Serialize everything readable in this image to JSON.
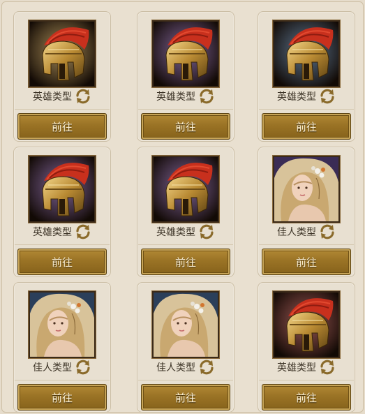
{
  "cards": [
    {
      "type_label": "英雄类型",
      "button_label": "前往",
      "portrait": "helmet",
      "bg": "#7a5a1e"
    },
    {
      "type_label": "英雄类型",
      "button_label": "前往",
      "portrait": "helmet",
      "bg": "#4a2a6e"
    },
    {
      "type_label": "英雄类型",
      "button_label": "前往",
      "portrait": "helmet",
      "bg": "#1f3f63"
    },
    {
      "type_label": "英雄类型",
      "button_label": "前往",
      "portrait": "helmet",
      "bg": "#4a2a6e"
    },
    {
      "type_label": "英雄类型",
      "button_label": "前往",
      "portrait": "helmet",
      "bg": "#4a2a6e"
    },
    {
      "type_label": "佳人类型",
      "button_label": "前往",
      "portrait": "maiden",
      "bg": "#3a2c55"
    },
    {
      "type_label": "佳人类型",
      "button_label": "前往",
      "portrait": "maiden",
      "bg": "#2b3f5a"
    },
    {
      "type_label": "佳人类型",
      "button_label": "前往",
      "portrait": "maiden",
      "bg": "#2b3f5a"
    },
    {
      "type_label": "英雄类型",
      "button_label": "前往",
      "portrait": "helmet",
      "bg": "#6a1a1a"
    }
  ],
  "icons": {
    "refresh": "refresh-icon",
    "helmet": "spartan-helmet-icon",
    "maiden": "maiden-portrait"
  }
}
